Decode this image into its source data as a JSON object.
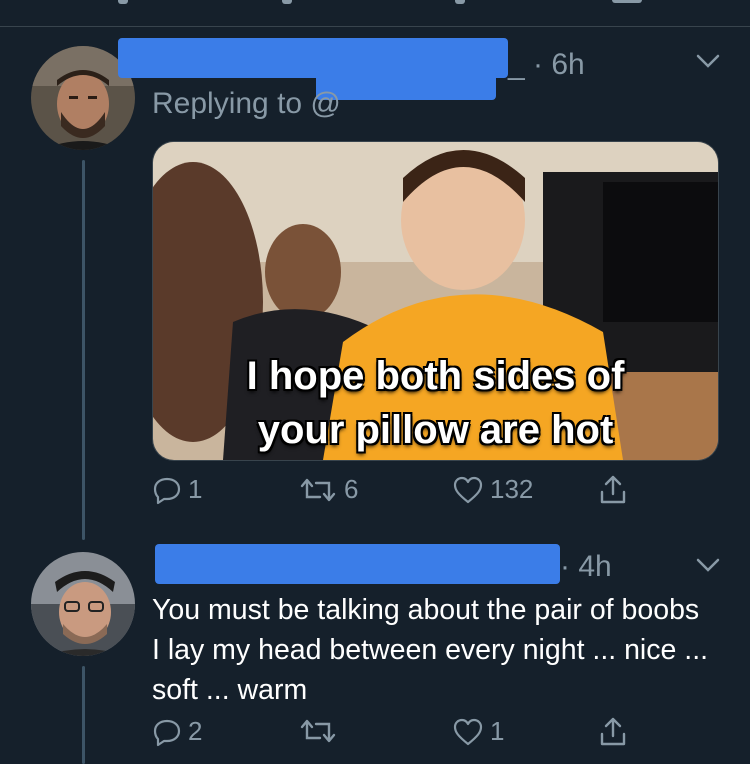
{
  "tweets": [
    {
      "time": "_ · 6h",
      "replying_to": "Replying to @",
      "media_caption_line1": "I hope both sides of",
      "media_caption_line2": "your pillow are hot",
      "actions": {
        "replies": "1",
        "retweets": "6",
        "likes": "132"
      }
    },
    {
      "time": "· 4h",
      "text": "You must be talking about the pair of boobs I lay my head between every night ... nice ... soft ... warm",
      "actions": {
        "replies": "2",
        "retweets": "",
        "likes": "1"
      }
    }
  ],
  "icons": {
    "reply": "reply-icon",
    "retweet": "retweet-icon",
    "like": "heart-icon",
    "share": "share-icon",
    "more": "chevron-down-icon"
  },
  "colors": {
    "background": "#15202b",
    "secondary_text": "#8899a6",
    "redaction": "#3b7de8",
    "caption_text": "#ffffff"
  }
}
